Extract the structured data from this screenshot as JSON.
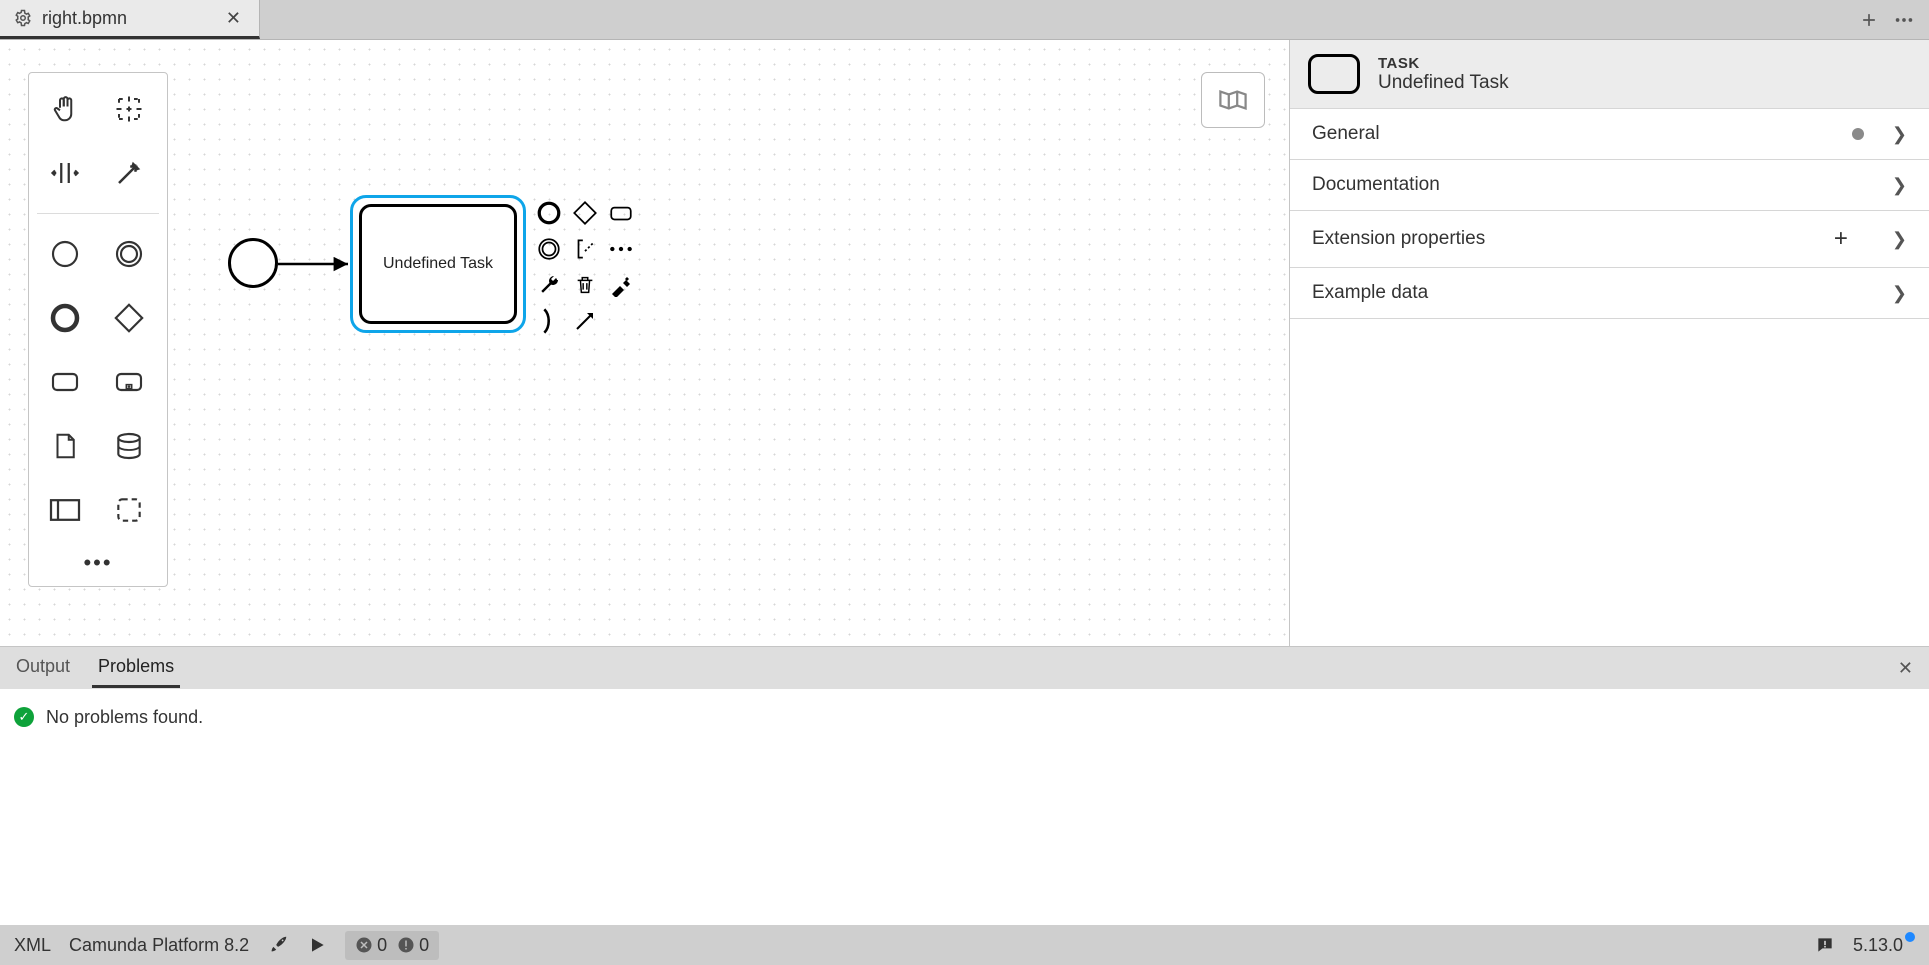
{
  "tab": {
    "title": "right.bpmn"
  },
  "task": {
    "label": "Undefined Task"
  },
  "panel": {
    "typeLabel": "TASK",
    "name": "Undefined Task",
    "sections": {
      "general": "General",
      "documentation": "Documentation",
      "extension": "Extension properties",
      "example": "Example data"
    }
  },
  "bottomTabs": {
    "output": "Output",
    "problems": "Problems"
  },
  "problems": {
    "message": "No problems found."
  },
  "status": {
    "xml": "XML",
    "platform": "Camunda Platform 8.2",
    "errors": "0",
    "warnings": "0",
    "version": "5.13.0"
  }
}
